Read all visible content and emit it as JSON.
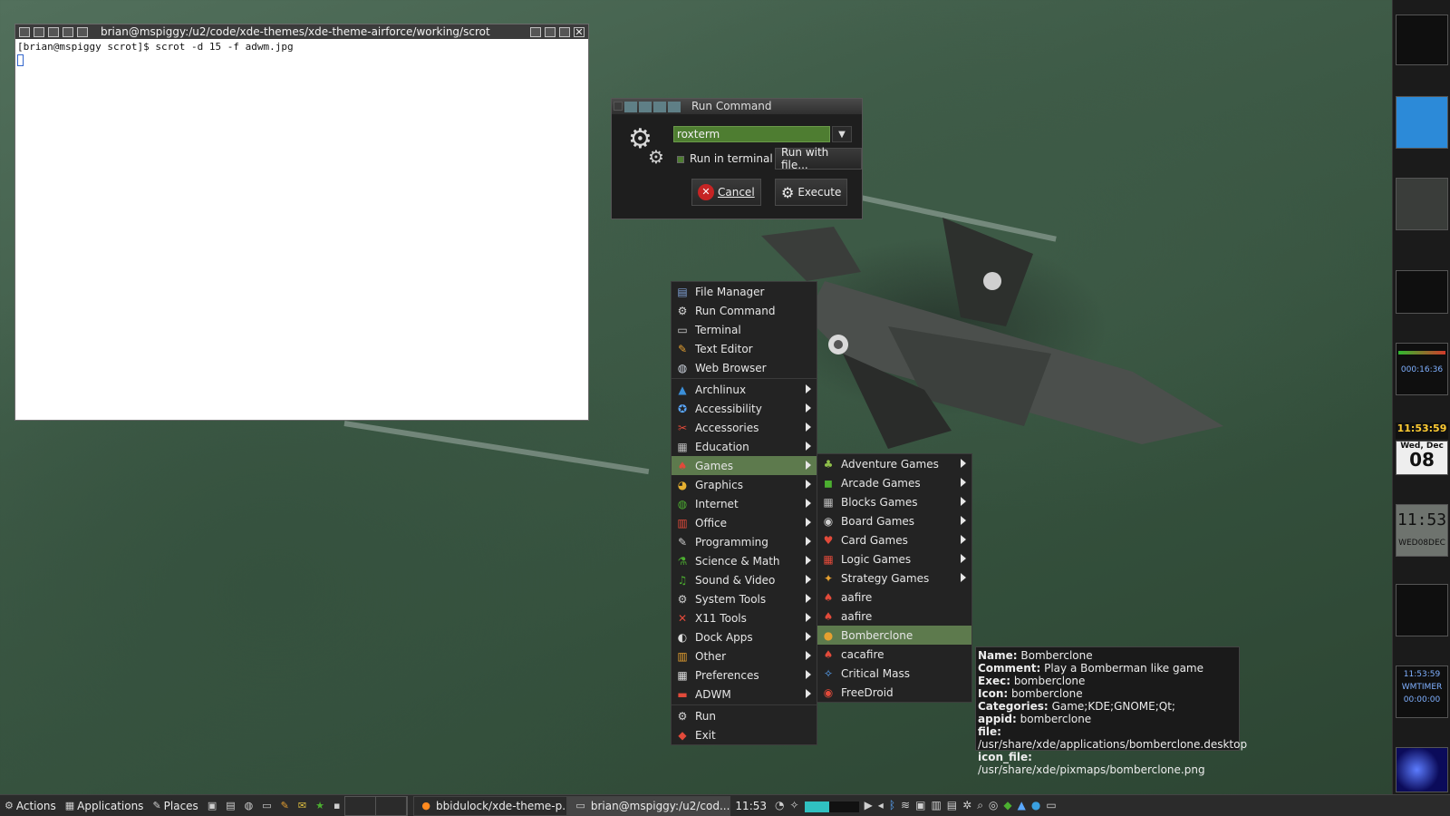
{
  "terminal": {
    "title": "brian@mspiggy:/u2/code/xde-themes/xde-theme-airforce/working/scrot",
    "prompt": "[brian@mspiggy scrot]$ scrot -d 15 -f adwm.jpg"
  },
  "run_dialog": {
    "title": "Run Command",
    "command_value": "roxterm",
    "run_in_terminal_label": "Run in terminal",
    "run_with_file_label": "Run with file...",
    "cancel_label": "Cancel",
    "execute_label": "Execute"
  },
  "main_menu": [
    {
      "label": "File Manager",
      "icon": "folder-icon",
      "sub": false
    },
    {
      "label": "Run Command",
      "icon": "gears-icon",
      "sub": false
    },
    {
      "label": "Terminal",
      "icon": "terminal-icon",
      "sub": false
    },
    {
      "label": "Text Editor",
      "icon": "text-editor-icon",
      "sub": false
    },
    {
      "label": "Web Browser",
      "icon": "globe-icon",
      "sub": false
    },
    {
      "label": "Archlinux",
      "icon": "arch-icon",
      "sub": true
    },
    {
      "label": "Accessibility",
      "icon": "accessibility-icon",
      "sub": true
    },
    {
      "label": "Accessories",
      "icon": "accessories-icon",
      "sub": true
    },
    {
      "label": "Education",
      "icon": "education-icon",
      "sub": true
    },
    {
      "label": "Games",
      "icon": "games-icon",
      "sub": true,
      "selected": true
    },
    {
      "label": "Graphics",
      "icon": "graphics-icon",
      "sub": true
    },
    {
      "label": "Internet",
      "icon": "internet-icon",
      "sub": true
    },
    {
      "label": "Office",
      "icon": "office-icon",
      "sub": true
    },
    {
      "label": "Programming",
      "icon": "programming-icon",
      "sub": true
    },
    {
      "label": "Science & Math",
      "icon": "science-icon",
      "sub": true
    },
    {
      "label": "Sound & Video",
      "icon": "sound-video-icon",
      "sub": true
    },
    {
      "label": "System Tools",
      "icon": "system-tools-icon",
      "sub": true
    },
    {
      "label": "X11 Tools",
      "icon": "x11-icon",
      "sub": true
    },
    {
      "label": "Dock Apps",
      "icon": "dock-apps-icon",
      "sub": true
    },
    {
      "label": "Other",
      "icon": "other-icon",
      "sub": true
    },
    {
      "label": "Preferences",
      "icon": "preferences-icon",
      "sub": true
    },
    {
      "label": "ADWM",
      "icon": "adwm-icon",
      "sub": true
    },
    {
      "label": "Run",
      "icon": "run-icon",
      "sub": false
    },
    {
      "label": "Exit",
      "icon": "exit-icon",
      "sub": false
    }
  ],
  "games_menu": [
    {
      "label": "Adventure Games",
      "icon": "adventure-icon",
      "sub": true
    },
    {
      "label": "Arcade Games",
      "icon": "arcade-icon",
      "sub": true
    },
    {
      "label": "Blocks Games",
      "icon": "blocks-icon",
      "sub": true
    },
    {
      "label": "Board Games",
      "icon": "board-icon",
      "sub": true
    },
    {
      "label": "Card Games",
      "icon": "cards-icon",
      "sub": true
    },
    {
      "label": "Logic Games",
      "icon": "logic-icon",
      "sub": true
    },
    {
      "label": "Strategy Games",
      "icon": "strategy-icon",
      "sub": true
    },
    {
      "label": "aafire",
      "icon": "game-icon",
      "sub": false
    },
    {
      "label": "aafire",
      "icon": "game-icon",
      "sub": false
    },
    {
      "label": "Bomberclone",
      "icon": "bomberclone-icon",
      "sub": false,
      "selected": true
    },
    {
      "label": "cacafire",
      "icon": "game-icon",
      "sub": false
    },
    {
      "label": "Critical Mass",
      "icon": "critical-mass-icon",
      "sub": false
    },
    {
      "label": "FreeDroid",
      "icon": "freedroid-icon",
      "sub": false
    }
  ],
  "tooltip": {
    "name_key": "Name:",
    "name_val": "Bomberclone",
    "comment_key": "Comment:",
    "comment_val": "Play a Bomberman like game",
    "exec_key": "Exec:",
    "exec_val": "bomberclone",
    "icon_key": "Icon:",
    "icon_val": "bomberclone",
    "categories_key": "Categories:",
    "categories_val": "Game;KDE;GNOME;Qt;",
    "appid_key": "appid:",
    "appid_val": "bomberclone",
    "file_key": "file:",
    "file_val": "/usr/share/xde/applications/bomberclone.desktop",
    "iconfile_key": "icon_file:",
    "iconfile_val": "/usr/share/xde/pixmaps/bomberclone.png"
  },
  "dock": {
    "clock_time": "11:53:59",
    "date_day": "Wed, Dec",
    "date_num": "08",
    "lcd_time": "11:53",
    "lcd_date": "WED08DEC",
    "timer_a": "000:16:36",
    "wmtimer_time": "11:53:59",
    "wmtimer_label": "WMTIMER",
    "wmtimer_count": "00:00:00"
  },
  "taskbar": {
    "actions": "Actions",
    "applications": "Applications",
    "places": "Places",
    "task1": "bbidulock/xde-theme-p...",
    "task2": "brian@mspiggy:/u2/cod...",
    "clock": "11:53"
  },
  "colors": {
    "selected": "#5d7a4d",
    "input_bg": "#4e7d31",
    "menu_bg": "#232323"
  }
}
